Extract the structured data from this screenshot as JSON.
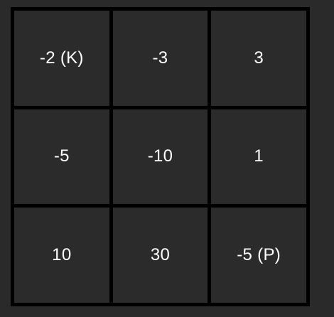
{
  "grid": {
    "cells": [
      {
        "label": "-2 (K)"
      },
      {
        "label": "-3"
      },
      {
        "label": "3"
      },
      {
        "label": "-5"
      },
      {
        "label": "-10"
      },
      {
        "label": "1"
      },
      {
        "label": "10"
      },
      {
        "label": "30"
      },
      {
        "label": "-5 (P)"
      }
    ]
  },
  "colors": {
    "background": "#2a2a2a",
    "cell": "#2b2b2b",
    "grid_line": "#000000",
    "text": "#ffffff"
  }
}
